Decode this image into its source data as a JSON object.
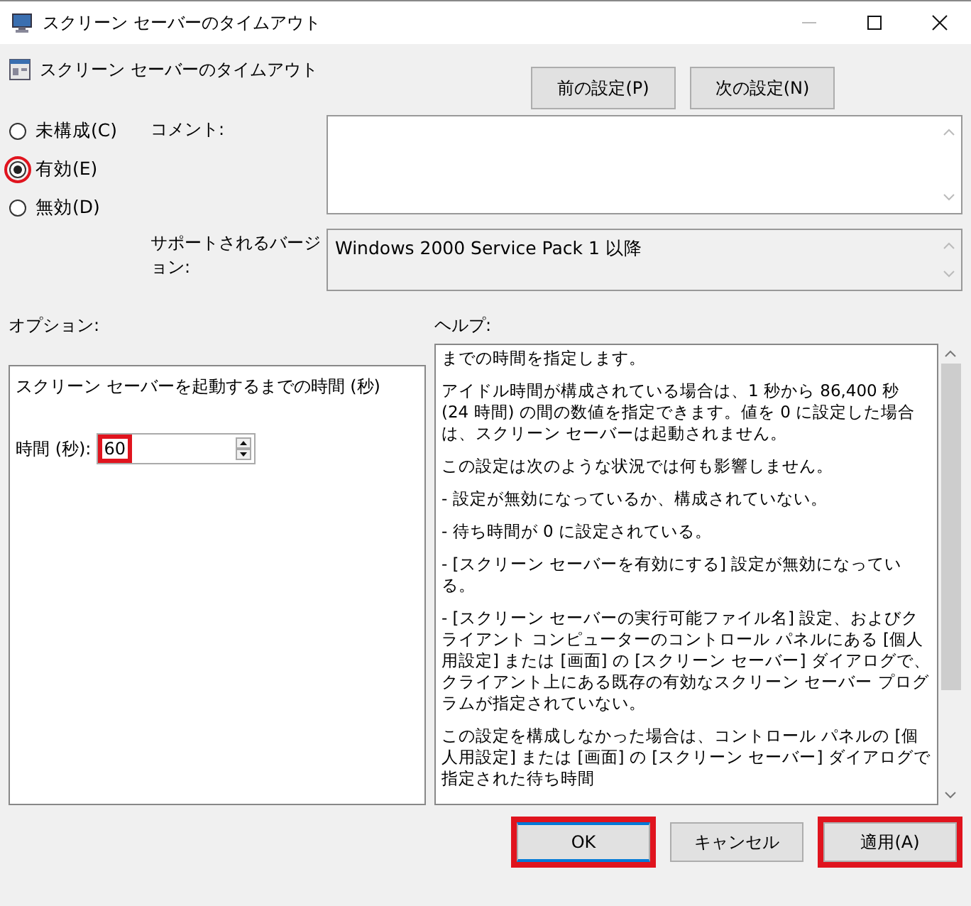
{
  "window": {
    "title": "スクリーン セーバーのタイムアウト"
  },
  "policy": {
    "title": "スクリーン セーバーのタイムアウト"
  },
  "nav_buttons": [
    {
      "label": "前の設定(P)"
    },
    {
      "label": "次の設定(N)"
    }
  ],
  "states": [
    {
      "label": "未構成(C)",
      "selected": false,
      "highlighted": false
    },
    {
      "label": "有効(E)",
      "selected": true,
      "highlighted": true
    },
    {
      "label": "無効(D)",
      "selected": false,
      "highlighted": false
    }
  ],
  "comment": {
    "label": "コメント:"
  },
  "supported": {
    "label": "サポートされるバージョン:",
    "value": "Windows 2000 Service Pack 1 以降"
  },
  "options": {
    "label": "オプション:",
    "description": "スクリーン セーバーを起動するまでの時間 (秒)",
    "field_label": "時間 (秒):",
    "value": "60",
    "highlighted": true
  },
  "help": {
    "label": "ヘルプ:",
    "paragraphs": [
      "までの時間を指定します。",
      " アイドル時間が構成されている場合は、1 秒から 86,400 秒 (24 時間) の間の数値を指定できます。値を 0 に設定した場合は、スクリーン セーバーは起動されません。",
      " この設定は次のような状況では何も影響しません。",
      " - 設定が無効になっているか、構成されていない。",
      " - 待ち時間が 0 に設定されている。",
      " - [スクリーン セーバーを有効にする] 設定が無効になっている。",
      " - [スクリーン セーバーの実行可能ファイル名] 設定、およびクライアント コンピューターのコントロール パネルにある [個人用設定] または [画面] の [スクリーン セーバー] ダイアログで、クライアント上にある既存の有効なスクリーン セーバー プログラムが指定されていない。",
      " この設定を構成しなかった場合は、コントロール パネルの [個人用設定] または [画面] の [スクリーン セーバー] ダイアログで指定された待ち時間"
    ]
  },
  "buttons": [
    {
      "label": "OK",
      "default": true,
      "highlighted": true
    },
    {
      "label": "キャンセル",
      "default": false,
      "highlighted": false
    },
    {
      "label": "適用(A)",
      "default": false,
      "highlighted": true
    }
  ]
}
